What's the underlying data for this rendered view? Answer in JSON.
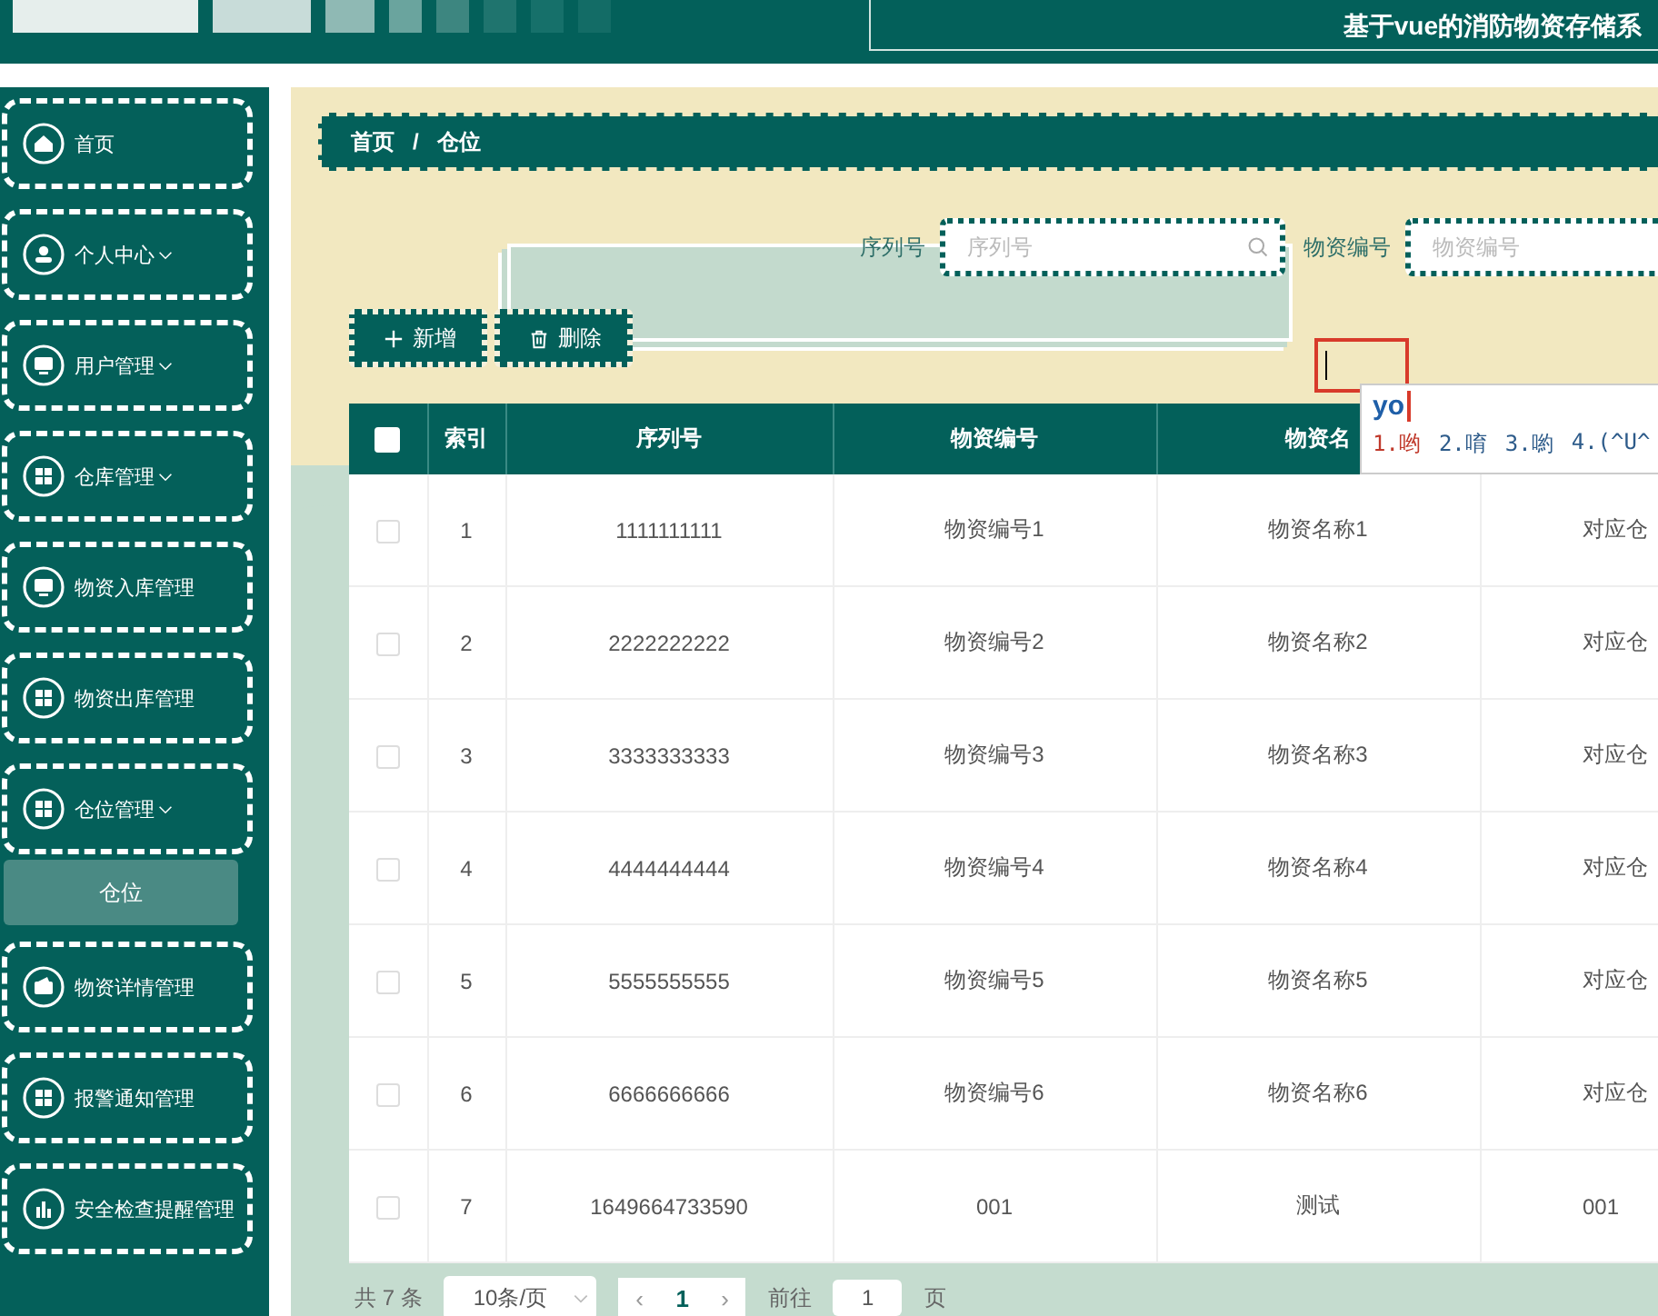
{
  "header": {
    "title": "基于vue的消防物资存储系"
  },
  "sidebar": {
    "items": [
      {
        "label": "首页",
        "kind": "link"
      },
      {
        "label": "个人中心",
        "kind": "group"
      },
      {
        "label": "用户管理",
        "kind": "group"
      },
      {
        "label": "仓库管理",
        "kind": "group"
      },
      {
        "label": "物资入库管理",
        "kind": "link"
      },
      {
        "label": "物资出库管理",
        "kind": "link"
      },
      {
        "label": "仓位管理",
        "kind": "group",
        "children": [
          {
            "label": "仓位",
            "selected": true
          }
        ]
      },
      {
        "label": "物资详情管理",
        "kind": "link"
      },
      {
        "label": "报警通知管理",
        "kind": "link"
      },
      {
        "label": "安全检查提醒管理",
        "kind": "link"
      }
    ]
  },
  "breadcrumb": [
    "首页",
    "/",
    "仓位"
  ],
  "search": [
    {
      "label": "序列号",
      "placeholder": "序列号"
    },
    {
      "label": "物资编号",
      "placeholder": "物资编号"
    }
  ],
  "buttons": [
    {
      "label": "新增",
      "kind": "add"
    },
    {
      "label": "删除",
      "kind": "delete"
    }
  ],
  "table": {
    "all_checked": false,
    "columns": [
      "索引",
      "序列号",
      "物资编号",
      "物资名"
    ],
    "rows": [
      {
        "checked": false,
        "cells": [
          "1",
          "1111111111",
          "物资编号1",
          "物资名称1",
          "对应仓"
        ]
      },
      {
        "checked": false,
        "cells": [
          "2",
          "2222222222",
          "物资编号2",
          "物资名称2",
          "对应仓"
        ]
      },
      {
        "checked": false,
        "cells": [
          "3",
          "3333333333",
          "物资编号3",
          "物资名称3",
          "对应仓"
        ]
      },
      {
        "checked": false,
        "cells": [
          "4",
          "4444444444",
          "物资编号4",
          "物资名称4",
          "对应仓"
        ]
      },
      {
        "checked": false,
        "cells": [
          "5",
          "5555555555",
          "物资编号5",
          "物资名称5",
          "对应仓"
        ]
      },
      {
        "checked": false,
        "cells": [
          "6",
          "6666666666",
          "物资编号6",
          "物资名称6",
          "对应仓"
        ]
      },
      {
        "checked": false,
        "cells": [
          "7",
          "1649664733590",
          "001",
          "测试",
          "001"
        ]
      }
    ]
  },
  "pagination": {
    "total": "共 7 条",
    "page_size": "10条/页",
    "prev": "‹",
    "page": "1",
    "next": "›",
    "goto_label": "前往",
    "goto_value": "1",
    "goto_suffix": "页"
  },
  "ime": {
    "input": "yo",
    "candidates": [
      "1.哟",
      "2.唷",
      "3.喲",
      "4.(^U^"
    ]
  }
}
